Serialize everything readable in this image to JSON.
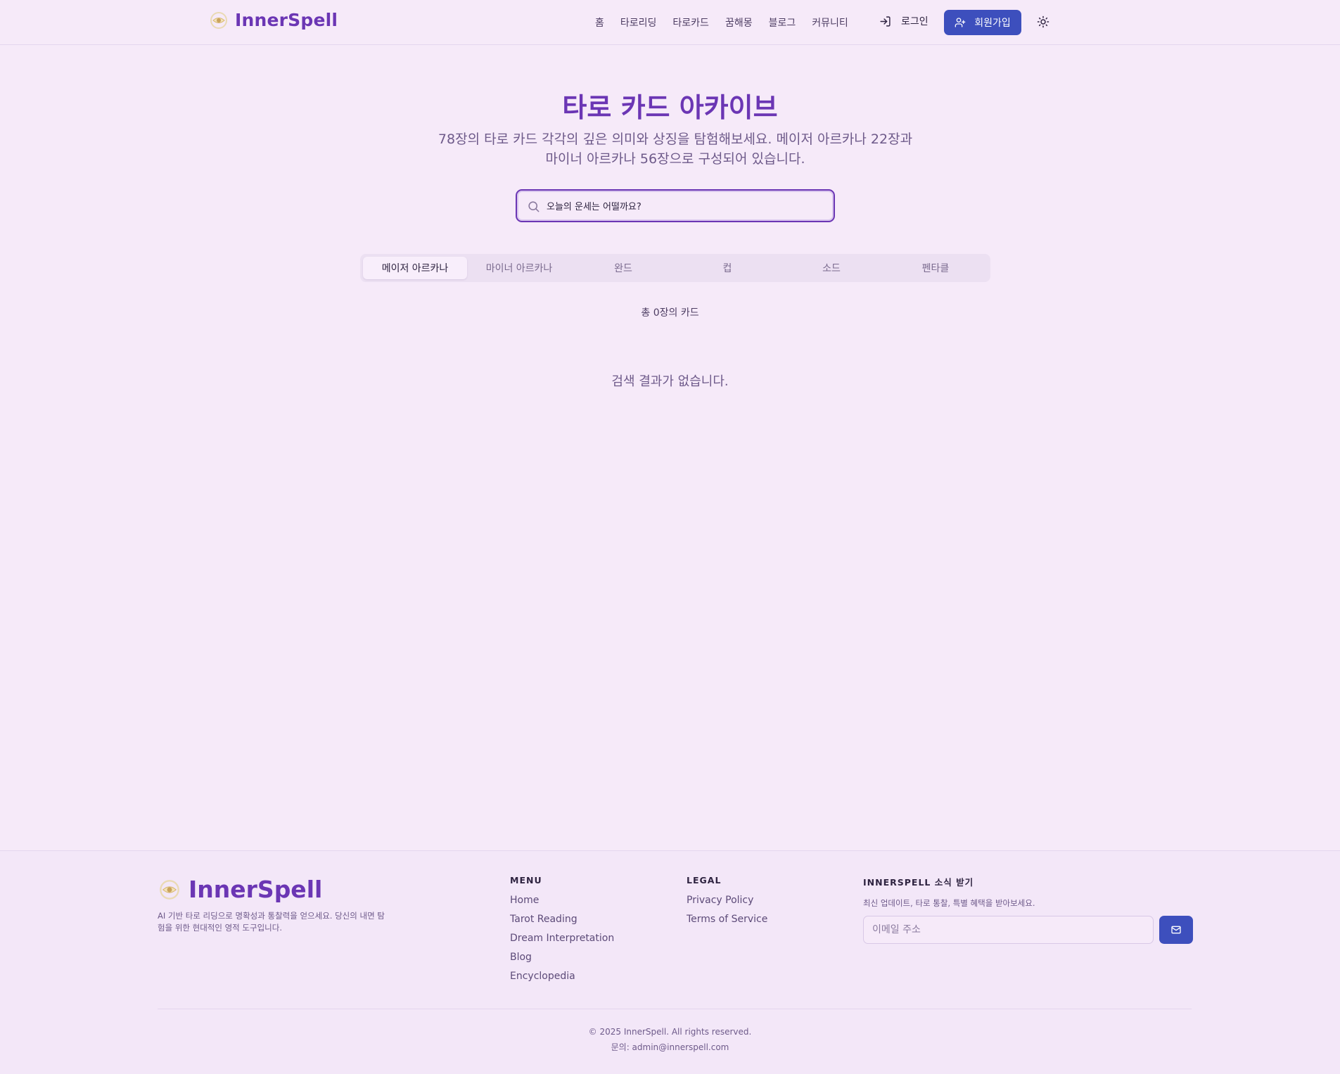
{
  "header": {
    "brand": "InnerSpell",
    "nav": [
      "홈",
      "타로리딩",
      "타로카드",
      "꿈해몽",
      "블로그",
      "커뮤니티"
    ],
    "login_label": "로그인",
    "signup_label": "회원가입"
  },
  "main": {
    "title": "타로 카드 아카이브",
    "subtitle": "78장의 타로 카드 각각의 깊은 의미와 상징을 탐험해보세요. 메이저 아르카나 22장과 마이너 아르카나 56장으로 구성되어 있습니다.",
    "search": {
      "value": "오늘의 운세는 어떨까요?"
    },
    "tabs": [
      {
        "label": "메이저 아르카나",
        "active": true
      },
      {
        "label": "마이너 아르카나",
        "active": false
      },
      {
        "label": "완드",
        "active": false
      },
      {
        "label": "컵",
        "active": false
      },
      {
        "label": "소드",
        "active": false
      },
      {
        "label": "펜타클",
        "active": false
      }
    ],
    "count_text": "총 0장의 카드",
    "empty_text": "검색 결과가 없습니다."
  },
  "footer": {
    "brand": "InnerSpell",
    "description": "AI 기반 타로 리딩으로 명확성과 통찰력을 얻으세요. 당신의 내면 탐험을 위한 현대적인 영적 도구입니다.",
    "menu": {
      "heading": "MENU",
      "items": [
        "Home",
        "Tarot Reading",
        "Dream Interpretation",
        "Blog",
        "Encyclopedia"
      ]
    },
    "legal": {
      "heading": "LEGAL",
      "items": [
        "Privacy Policy",
        "Terms of Service"
      ]
    },
    "newsletter": {
      "heading": "INNERSPELL 소식 받기",
      "text": "최신 업데이트, 타로 통찰, 특별 혜택을 받아보세요.",
      "placeholder": "이메일 주소"
    },
    "copyright": "© 2025 InnerSpell. All rights reserved.",
    "contact": "문의: admin@innerspell.com"
  },
  "colors": {
    "accent": "#6b36b4",
    "button": "#3d4fbd",
    "background": "#f6eaf9"
  },
  "icons": [
    "eye-logo-icon",
    "login-icon",
    "user-plus-icon",
    "sun-icon",
    "search-icon",
    "mail-icon"
  ]
}
